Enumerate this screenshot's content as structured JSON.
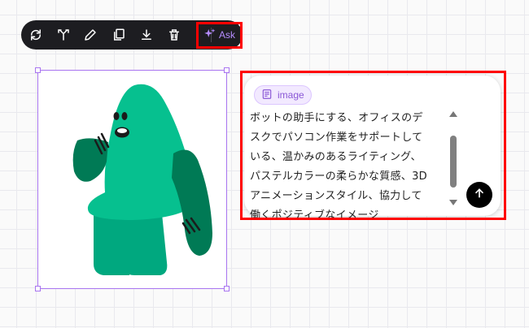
{
  "toolbar": {
    "tools": [
      "refresh-icon",
      "expand-icon",
      "pencil-icon",
      "copy-icon",
      "download-icon",
      "trash-icon"
    ],
    "ask_label": "Ask",
    "ask_color": "#b58cff"
  },
  "canvas": {
    "selection_color": "#a874f0",
    "character": {
      "body_color": "#06c08f",
      "dark_color": "#007a55",
      "mid_color": "#00a87f"
    }
  },
  "prompt": {
    "chip_label": "image",
    "lines": [
      "ボットの助手にする、オフィスのデ",
      "スクでパソコン作業をサポートして",
      "いる、温かみのあるライティング、",
      "パステルカラーの柔らかな質感、3D",
      "アニメーションスタイル、協力して",
      "働くポジティブなイメージ"
    ]
  },
  "highlight_color": "#ff0000"
}
